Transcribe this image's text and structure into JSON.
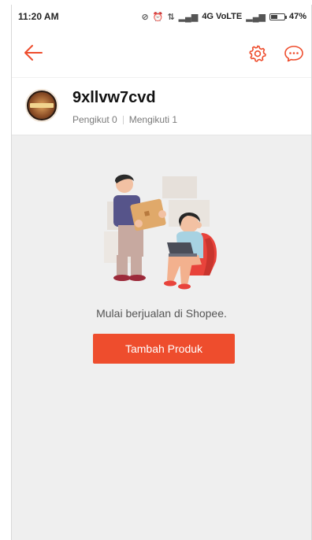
{
  "status_bar": {
    "time": "11:20 AM",
    "network": "4G VoLTE",
    "battery": "47%"
  },
  "header": {
    "back_icon": "arrow-left-icon",
    "settings_icon": "gear-icon",
    "chat_icon": "chat-bubble-icon",
    "accent_color": "#ee4d2d"
  },
  "profile": {
    "username": "9xllvw7cvd",
    "followers_label": "Pengikut 0",
    "following_label": "Mengikuti 1"
  },
  "empty_state": {
    "message": "Mulai berjualan di Shopee.",
    "cta_label": "Tambah Produk"
  }
}
